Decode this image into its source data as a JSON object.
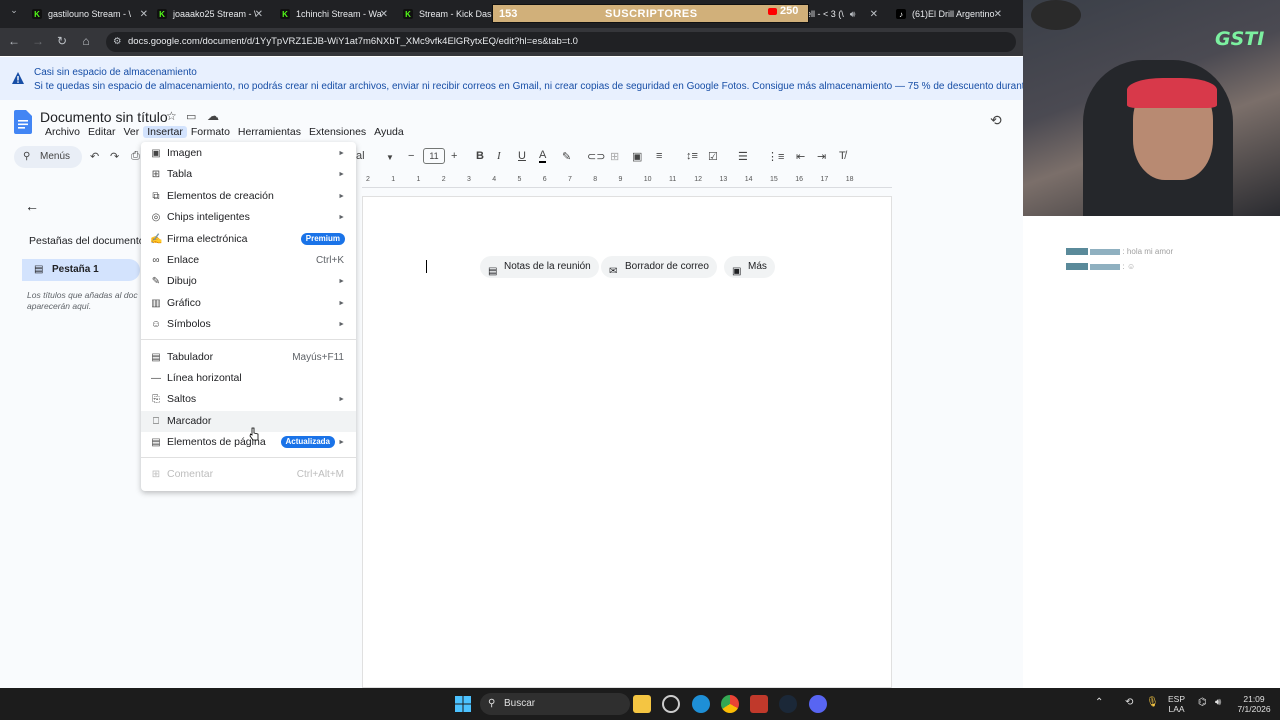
{
  "browser": {
    "tabs": [
      {
        "label": "gastilouno Stream - \\"
      },
      {
        "label": "joaaako25 Stream - \\"
      },
      {
        "label": "1chinchi Stream - Wa"
      },
      {
        "label": "Stream - Kick Dashb"
      },
      {
        "label": "gram"
      },
      {
        "label": "ell - < 3 (\\"
      },
      {
        "label": "(61)El Drill Argentino"
      }
    ],
    "url": "docs.google.com/document/d/1YyTpVRZ1EJB-WiY1at7m6NXbT_XMc9vfk4ElGRytxEQ/edit?hl=es&tab=t.0"
  },
  "overlay": {
    "sub_count": "153",
    "sub_label": "SUSCRIPTORES",
    "yt_count": "250",
    "logo": "GSTI"
  },
  "banner": {
    "title": "Casi sin espacio de almacenamiento",
    "body": "Si te quedas sin espacio de almacenamiento, no podrás crear ni editar archivos, enviar ni recibir correos en Gmail, ni crear copias de seguridad en Google Fotos. Consigue más almacenamiento — 75 % de descuento durante 3 meses."
  },
  "docs": {
    "title": "Documento sin título",
    "menu": [
      "Archivo",
      "Editar",
      "Ver",
      "Insertar",
      "Formato",
      "Herramientas",
      "Extensiones",
      "Ayuda"
    ],
    "menus_label": "Menús",
    "font_partial": "al",
    "font_size": "11",
    "sidebar": {
      "heading": "Pestañas del documento",
      "tab1": "Pestaña 1",
      "hint": "Los títulos que añadas al doc aparecerán aquí."
    },
    "chips": [
      "Notas de la reunión",
      "Borrador de correo",
      "Más"
    ],
    "ruler_ticks": [
      "2",
      "1",
      "1",
      "2",
      "3",
      "4",
      "5",
      "6",
      "7",
      "8",
      "9",
      "10",
      "11",
      "12",
      "13",
      "14",
      "15",
      "16",
      "17",
      "18"
    ]
  },
  "insert_menu": {
    "items": [
      {
        "label": "Imagen",
        "arrow": "►"
      },
      {
        "label": "Tabla",
        "arrow": "►"
      },
      {
        "label": "Elementos de creación",
        "arrow": "►"
      },
      {
        "label": "Chips inteligentes",
        "arrow": "►"
      },
      {
        "label": "Firma electrónica",
        "badge": "Premium"
      },
      {
        "label": "Enlace",
        "shortcut": "Ctrl+K"
      },
      {
        "label": "Dibujo",
        "arrow": "►"
      },
      {
        "label": "Gráfico",
        "arrow": "►"
      },
      {
        "label": "Símbolos",
        "arrow": "►"
      },
      {
        "label": "Tabulador",
        "shortcut": "Mayús+F11"
      },
      {
        "label": "Línea horizontal"
      },
      {
        "label": "Saltos",
        "arrow": "►"
      },
      {
        "label": "Marcador"
      },
      {
        "label": "Elementos de página",
        "badge": "Actualizada",
        "arrow": "►"
      },
      {
        "label": "Comentar",
        "shortcut": "Ctrl+Alt+M"
      }
    ]
  },
  "chat": {
    "line1_text": ": hola mi amor",
    "line2_text": ":"
  },
  "taskbar": {
    "search": "Buscar",
    "lang1": "ESP",
    "lang2": "LAA",
    "time": "21:09",
    "date": "7/1/2026"
  },
  "colors": {
    "docs_blue": "#1a73e8",
    "banner_bg": "#e8f0fe",
    "sub_bar": "#d1b07a"
  }
}
